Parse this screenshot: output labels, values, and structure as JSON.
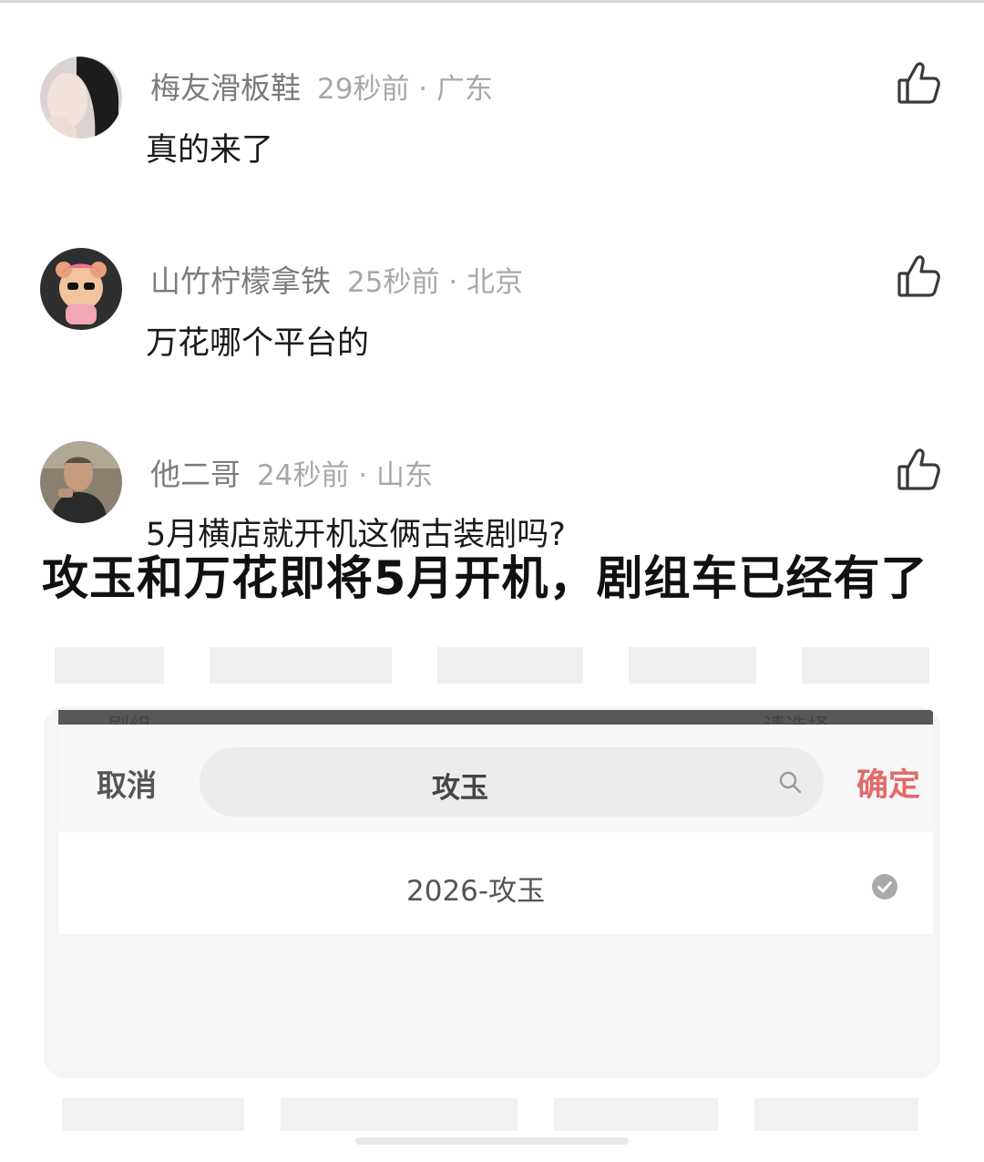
{
  "comments": [
    {
      "username": "梅友滑板鞋",
      "time_location": "29秒前 · 广东",
      "text": "真的来了"
    },
    {
      "username": "山竹柠檬拿铁",
      "time_location": "25秒前 · 北京",
      "text": "万花哪个平台的"
    },
    {
      "username": "他二哥",
      "time_location": "24秒前 · 山东",
      "text": "5月横店就开机这俩古装剧吗?"
    }
  ],
  "headline": "攻玉和万花即将5月开机，剧组车已经有了",
  "picker": {
    "field_label_partial": "剧组",
    "field_value_partial": "请选择",
    "cancel_label": "取消",
    "search_value": "攻玉",
    "confirm_label": "确定",
    "option": "2026-攻玉",
    "confirm_color": "#e26a6a"
  },
  "icons": {
    "like": "thumbs-up-icon",
    "search": "search-icon",
    "check": "check-circle-icon"
  }
}
